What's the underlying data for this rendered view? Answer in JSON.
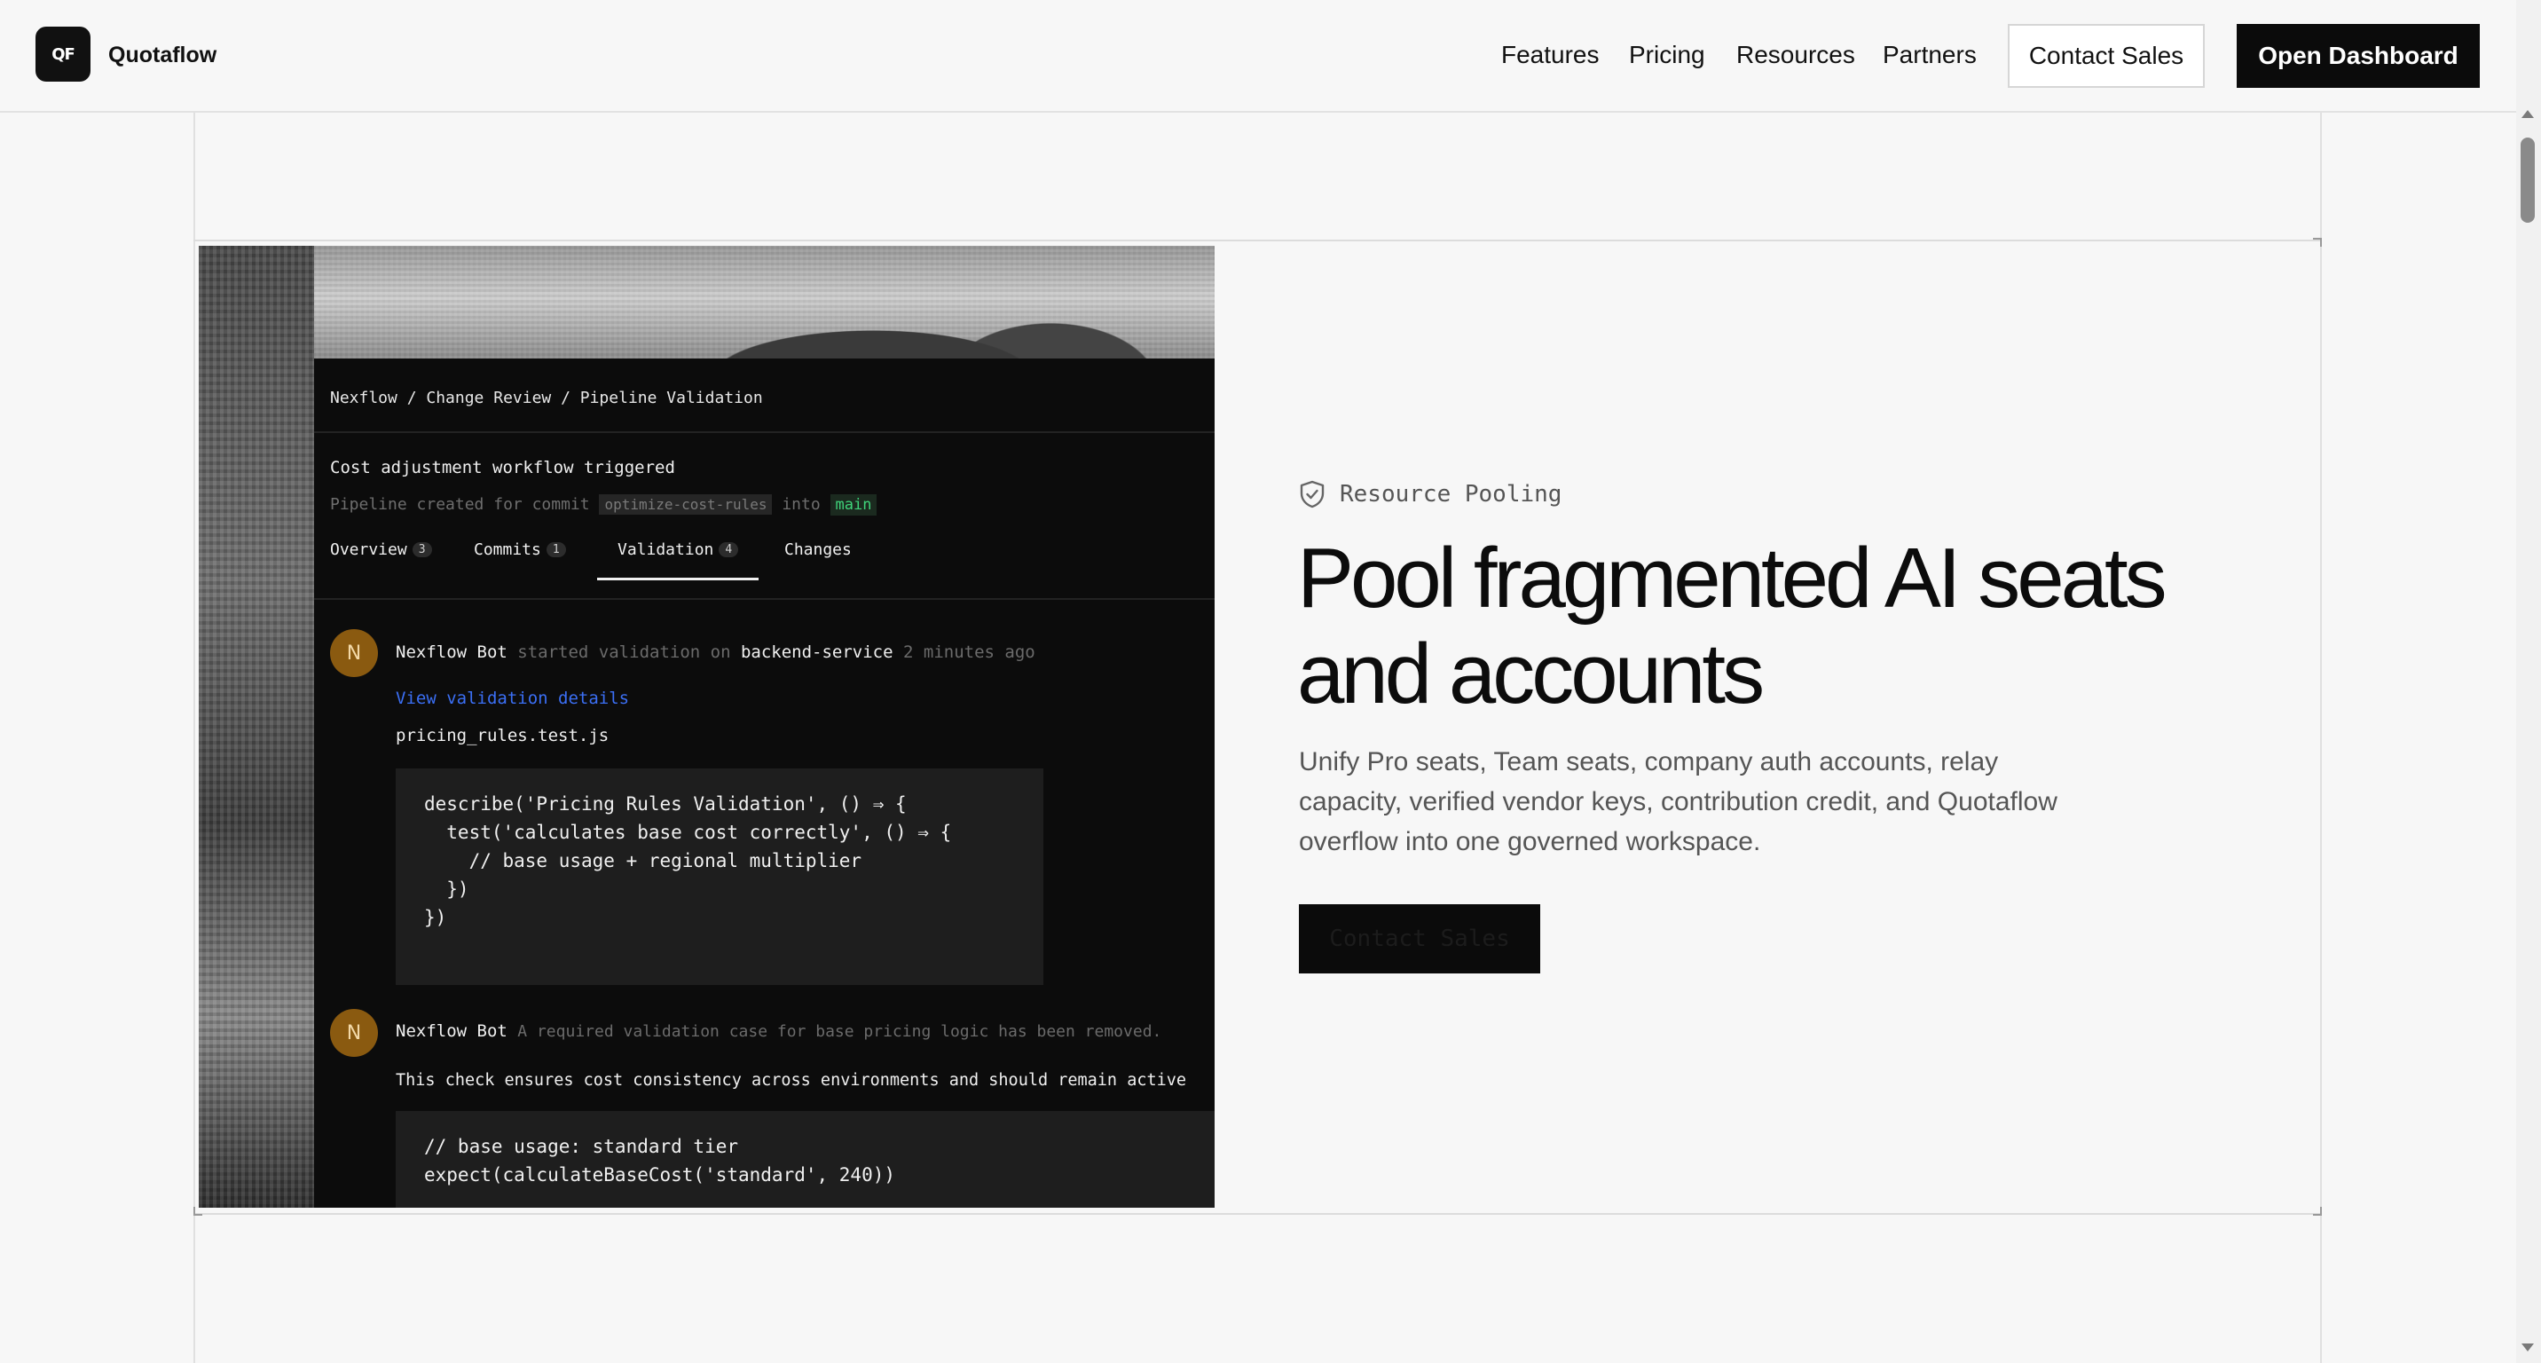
{
  "header": {
    "logo_mark": "QF",
    "brand": "Quotaflow",
    "nav": [
      "Features",
      "Pricing",
      "Resources",
      "Partners"
    ],
    "contact_sales": "Contact Sales",
    "open_dashboard": "Open Dashboard"
  },
  "app": {
    "breadcrumb": "Nexflow / Change Review / Pipeline Validation",
    "title": "Cost adjustment workflow triggered",
    "subtitle_prefix": "Pipeline created for commit",
    "commit_chip": "optimize-cost-rules",
    "subtitle_into": "into",
    "branch_chip": "main",
    "tabs": [
      {
        "label": "Overview",
        "count": "3"
      },
      {
        "label": "Commits",
        "count": "1"
      },
      {
        "label": "Validation",
        "count": "4"
      },
      {
        "label": "Changes",
        "count": ""
      }
    ],
    "activity": [
      {
        "avatar": "N",
        "author": "Nexflow Bot",
        "action": "started validation on",
        "target": "backend-service",
        "time": "2 minutes ago",
        "link": "View validation details",
        "file": "pricing_rules.test.js",
        "code": "describe('Pricing Rules Validation', () ⇒ {\n  test('calculates base cost correctly', () ⇒ {\n    // base usage + regional multiplier\n  })\n})"
      },
      {
        "avatar": "N",
        "author": "Nexflow Bot",
        "note": "A required validation case for base pricing logic has been removed.",
        "body": "This check ensures cost consistency across environments and should remain active",
        "code": "// base usage: standard tier\nexpect(calculateBaseCost('standard', 240))"
      }
    ]
  },
  "feature": {
    "eyebrow": "Resource Pooling",
    "eyebrow_icon": "shield-check-icon",
    "headline": "Pool fragmented AI seats and accounts",
    "description": "Unify Pro seats, Team seats, company auth accounts, relay capacity, verified vendor keys, contribution credit, and Quotaflow overflow into one governed workspace.",
    "cta": "Contact Sales"
  }
}
